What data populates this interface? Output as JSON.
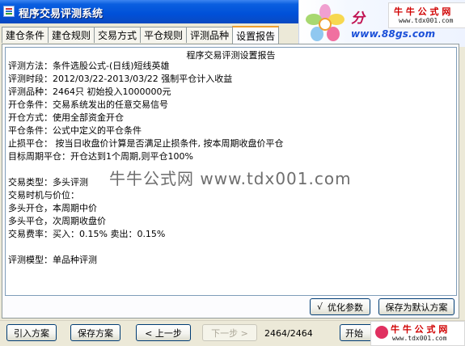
{
  "window": {
    "title": "程序交易评测系统"
  },
  "logo": {
    "fen_text": "分",
    "badge_title": "牛 牛 公 式 网",
    "badge_url": "www.tdx001.com",
    "www": "www.88gs.com"
  },
  "tabs": [
    {
      "label": "建仓条件"
    },
    {
      "label": "建仓规则"
    },
    {
      "label": "交易方式"
    },
    {
      "label": "平仓规则"
    },
    {
      "label": "评测品种"
    },
    {
      "label": "设置报告",
      "active": true
    }
  ],
  "report": {
    "title": "程序交易评测设置报告",
    "lines": [
      "评测方法：条件选股公式-(日线)短线英雄",
      "评测时段：2012/03/22-2013/03/22 强制平仓计入收益",
      "评测品种：2464只 初始投入1000000元",
      "开仓条件：交易系统发出的任意交易信号",
      "开仓方式：使用全部资金开仓",
      "平仓条件：公式中定义的平仓条件",
      "止损平仓：  按当日收盘价计算是否满足止损条件, 按本周期收盘价平仓",
      "            目标周期平仓：开仓达到1个周期,则平仓100%",
      "交易类型：多头评测",
      "交易时机与价位：",
      "          多头开仓，本周期中价",
      "          多头平仓，次周期收盘价",
      "交易费率：买入：0.15%    卖出：0.15%",
      "评测模型：单品种评测"
    ],
    "watermark": "牛牛公式网 www.tdx001.com"
  },
  "panel_buttons": {
    "optimize": "优化参数",
    "optimize_check": "√",
    "save_default": "保存为默认方案"
  },
  "bottom": {
    "import": "引入方案",
    "save": "保存方案",
    "prev": "< 上一步",
    "next": "下一步 >",
    "counter": "2464/2464",
    "start": "开始",
    "logo_title": "牛 牛 公 式 网",
    "logo_url": "www.tdx001.com"
  }
}
